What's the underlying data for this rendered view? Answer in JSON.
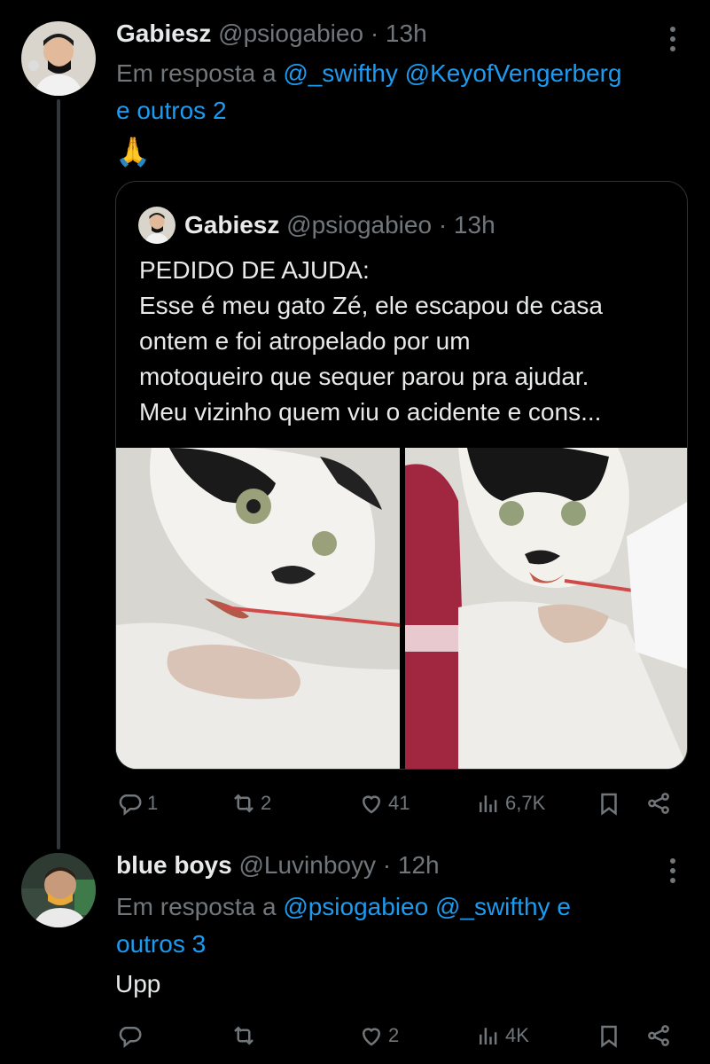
{
  "tweet1": {
    "display_name": "Gabiesz",
    "handle": "@psiogabieo",
    "time": "· 13h",
    "reply_prefix": "Em resposta a",
    "mentions": [
      "@_swifthy",
      "@KeyofVengerberg"
    ],
    "others": "e outros 2",
    "emoji": "🙏",
    "quote": {
      "display_name": "Gabiesz",
      "handle": "@psiogabieo",
      "time": "· 13h",
      "lines": [
        "PEDIDO DE AJUDA:",
        "Esse é meu gato Zé, ele escapou de casa",
        "ontem e foi atropelado por um",
        "motoqueiro que sequer parou pra ajudar.",
        "Meu vizinho quem viu o acidente e cons..."
      ]
    },
    "stats": {
      "replies": "1",
      "retweets": "2",
      "likes": "41",
      "views": "6,7K"
    }
  },
  "tweet2": {
    "display_name": "blue boys",
    "handle": "@Luvinboyy",
    "time": "· 12h",
    "reply_prefix": "Em resposta a",
    "mentions": [
      "@psiogabieo",
      "@_swifthy"
    ],
    "others_prefix": "e",
    "others": "outros 3",
    "text": "Upp",
    "stats": {
      "replies": "",
      "retweets": "",
      "likes": "2",
      "views": "4K"
    }
  },
  "colors": {
    "background": "#000000",
    "link": "#1d9bf0",
    "muted": "#71767b",
    "text": "#e7e9ea"
  },
  "icons": [
    "reply-icon",
    "retweet-icon",
    "like-icon",
    "views-icon",
    "bookmark-icon",
    "share-icon",
    "more-icon"
  ]
}
